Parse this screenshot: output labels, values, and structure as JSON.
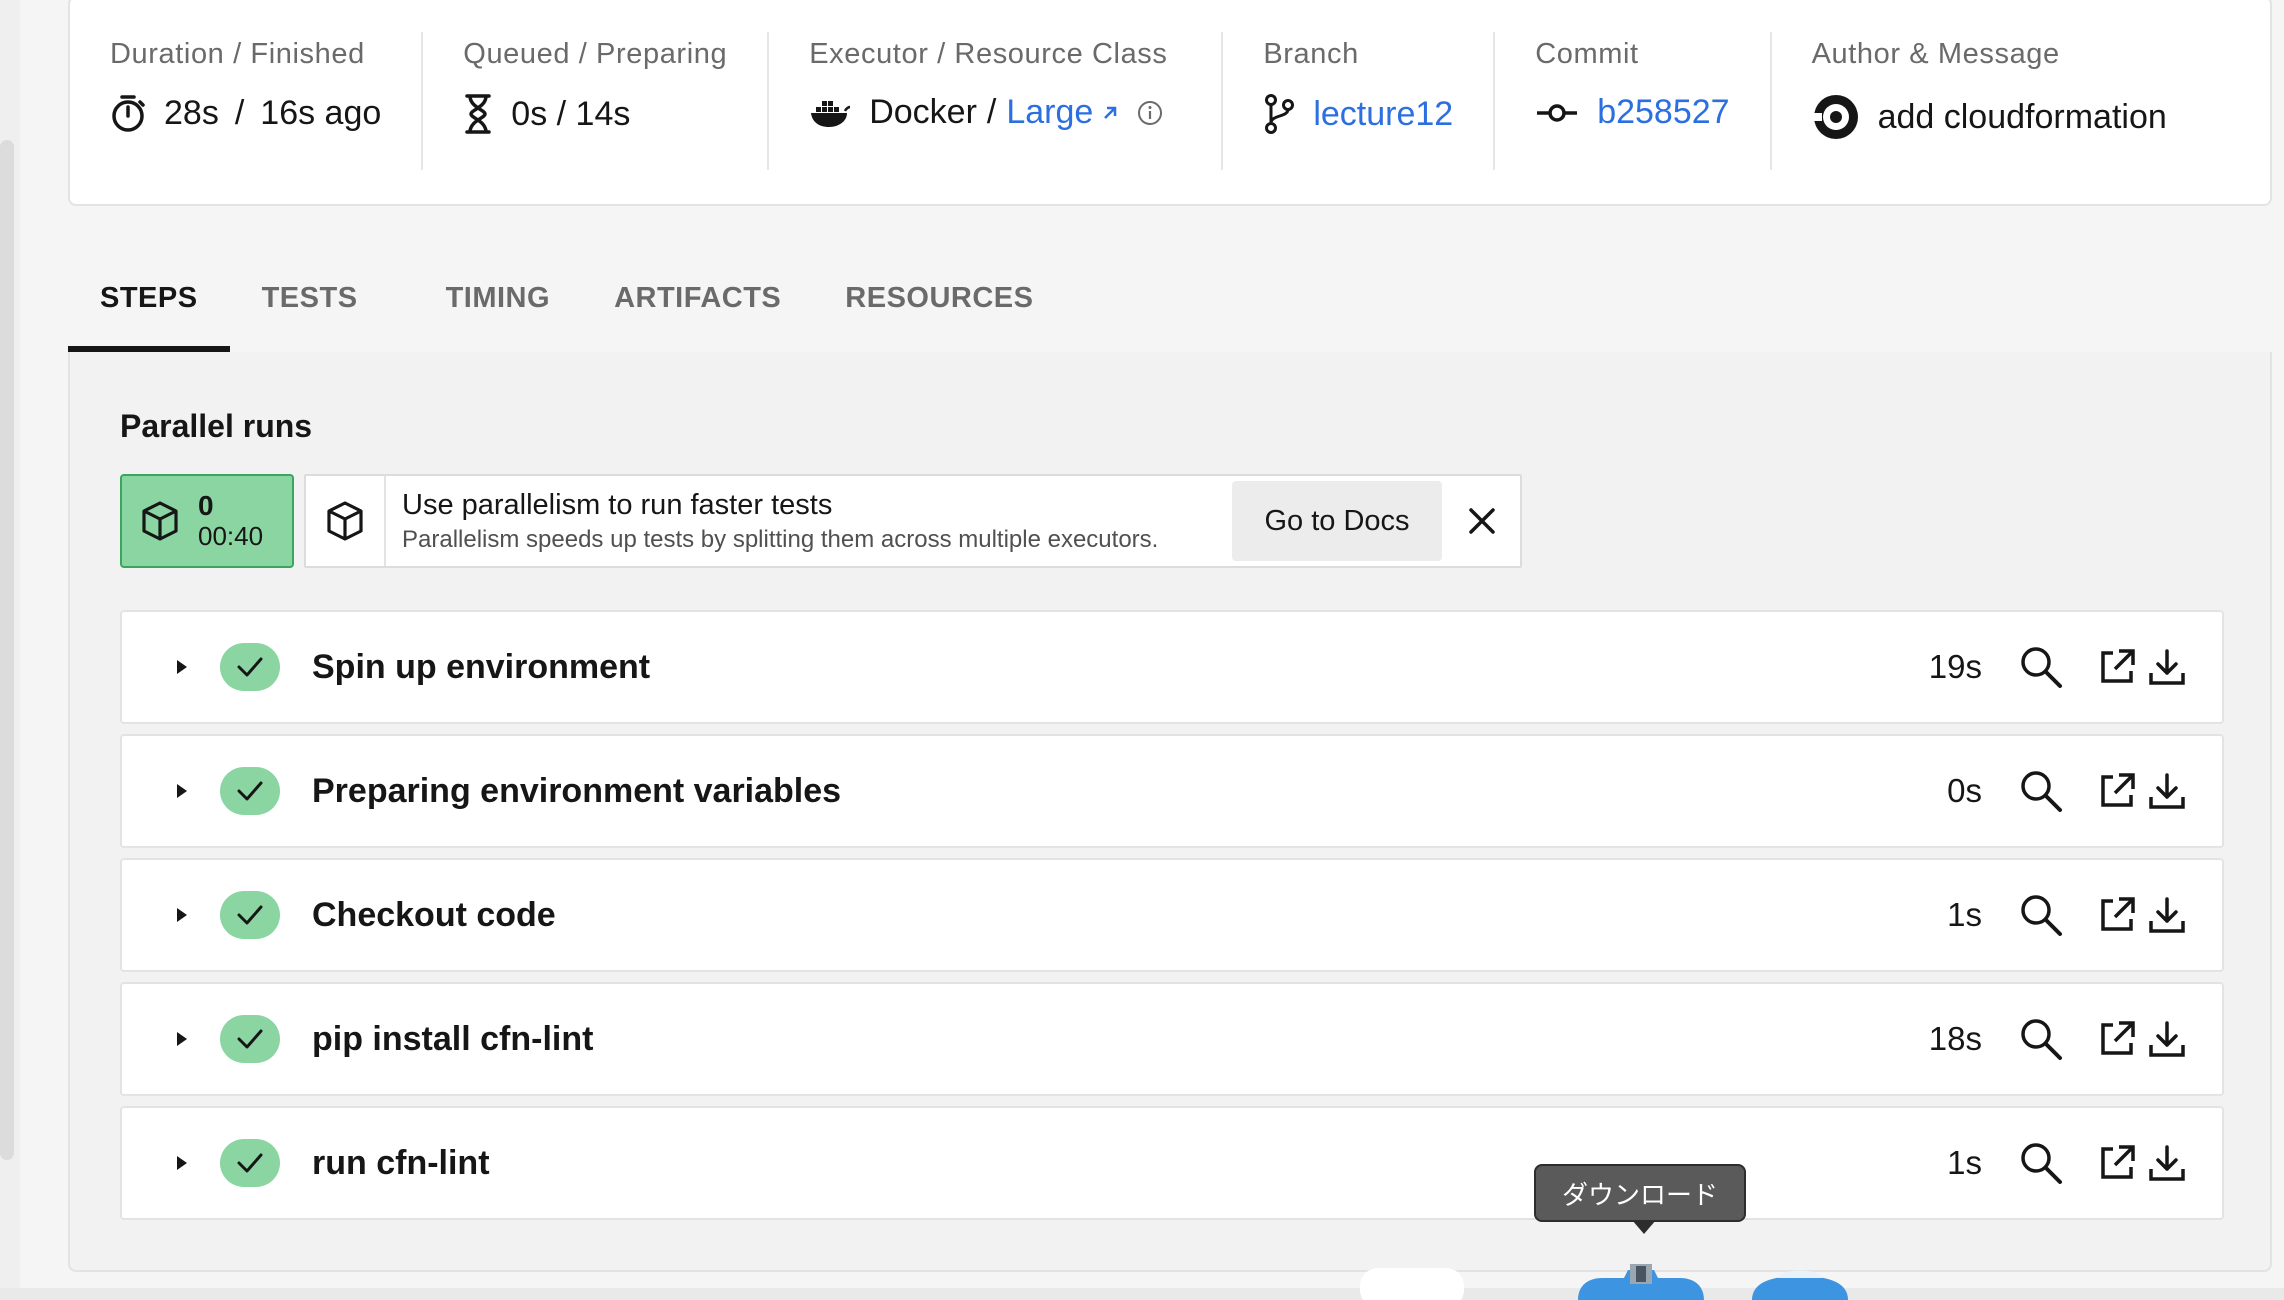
{
  "summary": {
    "duration": {
      "label": "Duration / Finished",
      "duration": "28s",
      "separator": "/",
      "finished": "16s ago",
      "icon": "stopwatch-icon"
    },
    "queued": {
      "label": "Queued / Preparing",
      "value": "0s / 14s",
      "icon": "hourglass-icon"
    },
    "executor": {
      "label": "Executor / Resource Class",
      "executor": "Docker",
      "separator": "/",
      "resource_class": "Large",
      "icon": "docker-icon"
    },
    "branch": {
      "label": "Branch",
      "value": "lecture12",
      "icon": "branch-icon"
    },
    "commit": {
      "label": "Commit",
      "value": "b258527",
      "icon": "commit-icon"
    },
    "author": {
      "label": "Author & Message",
      "message": "add cloudformation",
      "icon": "circleci-logo-icon"
    }
  },
  "tabs": [
    {
      "label": "STEPS",
      "active": true
    },
    {
      "label": "TESTS",
      "active": false
    },
    {
      "label": "TIMING",
      "active": false
    },
    {
      "label": "ARTIFACTS",
      "active": false
    },
    {
      "label": "RESOURCES",
      "active": false
    }
  ],
  "parallel": {
    "title": "Parallel runs",
    "run_index": "0",
    "run_time": "00:40",
    "banner_title": "Use parallelism to run faster tests",
    "banner_subtitle": "Parallelism speeds up tests by splitting them across multiple executors.",
    "docs_button": "Go to Docs"
  },
  "steps": [
    {
      "name": "Spin up environment",
      "duration": "19s",
      "status": "success"
    },
    {
      "name": "Preparing environment variables",
      "duration": "0s",
      "status": "success"
    },
    {
      "name": "Checkout code",
      "duration": "1s",
      "status": "success"
    },
    {
      "name": "pip install cfn-lint",
      "duration": "18s",
      "status": "success"
    },
    {
      "name": "run cfn-lint",
      "duration": "1s",
      "status": "success"
    }
  ],
  "tooltip": {
    "text": "ダウンロード"
  },
  "colors": {
    "success": "#8ad5a2",
    "success_border": "#39a660",
    "link": "#2b6fe0",
    "text": "#161616",
    "muted": "#6a6a6a"
  }
}
